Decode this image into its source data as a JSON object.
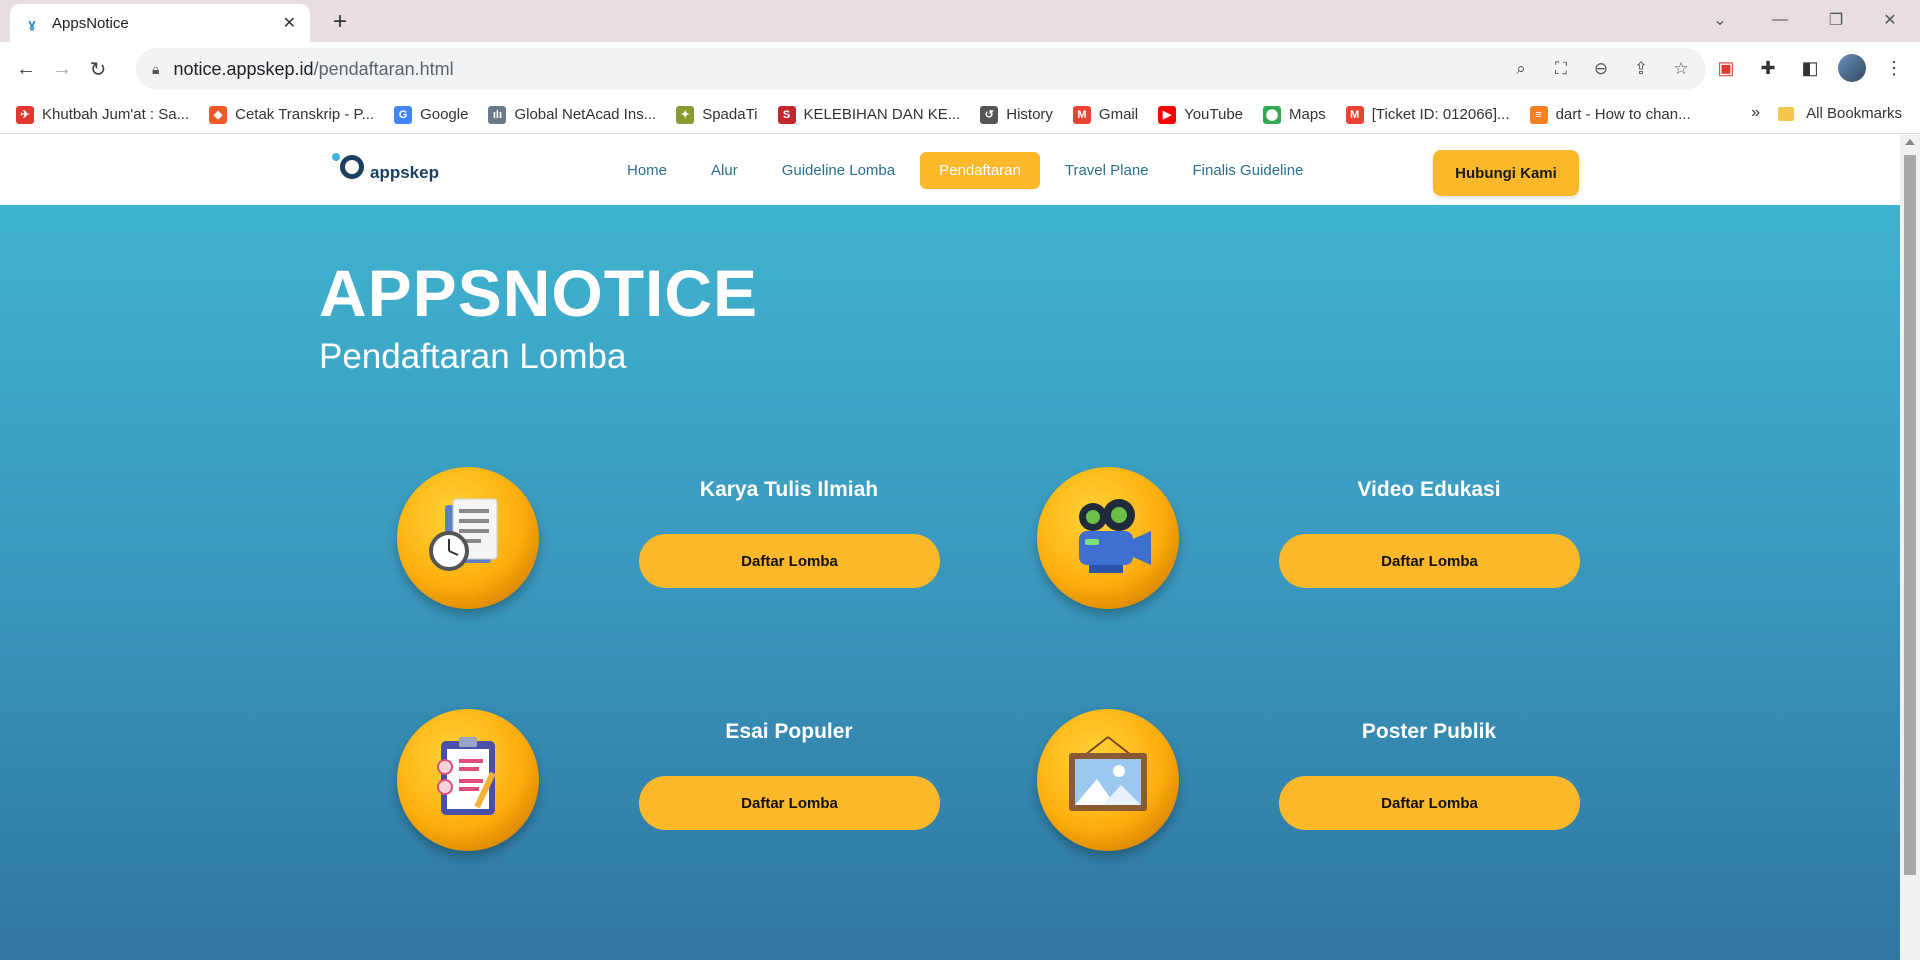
{
  "browser": {
    "tab_title": "AppsNotice",
    "url_domain": "notice.appskep.id",
    "url_path": "/pendaftaran.html",
    "bookmarks": [
      {
        "label": "Khutbah Jum'at : Sa...",
        "icon": "red-bird-icon",
        "color": "#e0382e"
      },
      {
        "label": "Cetak Transkrip - P...",
        "icon": "orange-hex-icon",
        "color": "#f05a28"
      },
      {
        "label": "Google",
        "icon": "google-icon",
        "color": "#4285f4"
      },
      {
        "label": "Global NetAcad Ins...",
        "icon": "cisco-icon",
        "color": "#6a7a8a"
      },
      {
        "label": "SpadaTi",
        "icon": "spadati-icon",
        "color": "#8a9a30"
      },
      {
        "label": "KELEBIHAN DAN KE...",
        "icon": "s-icon",
        "color": "#c0282e"
      },
      {
        "label": "History",
        "icon": "history-icon",
        "color": "#555555"
      },
      {
        "label": "Gmail",
        "icon": "gmail-icon",
        "color": "#ea4335"
      },
      {
        "label": "YouTube",
        "icon": "youtube-icon",
        "color": "#ff0000"
      },
      {
        "label": "Maps",
        "icon": "maps-icon",
        "color": "#34a853"
      },
      {
        "label": "[Ticket ID: 012066]...",
        "icon": "gmail-icon",
        "color": "#ea4335"
      },
      {
        "label": "dart - How to chan...",
        "icon": "stackoverflow-icon",
        "color": "#f48024"
      }
    ],
    "all_bookmarks": "All Bookmarks"
  },
  "site": {
    "logo_text": "appskep",
    "menu": [
      "Home",
      "Alur",
      "Guideline Lomba",
      "Pendaftaran",
      "Travel Plane",
      "Finalis Guideline"
    ],
    "active_menu": "Pendaftaran",
    "cta": "Hubungi Kami"
  },
  "hero": {
    "title": "APPSNOTICE",
    "subtitle": "Pendaftaran Lomba"
  },
  "competitions": [
    {
      "title": "Karya Tulis Ilmiah",
      "button": "Daftar Lomba",
      "icon": "document-clock-icon"
    },
    {
      "title": "Video Edukasi",
      "button": "Daftar Lomba",
      "icon": "video-camera-icon"
    },
    {
      "title": "Esai Populer",
      "button": "Daftar Lomba",
      "icon": "clipboard-checklist-icon"
    },
    {
      "title": "Poster Publik",
      "button": "Daftar Lomba",
      "icon": "picture-frame-icon"
    }
  ],
  "colors": {
    "accent": "#fbb82b",
    "hero_top": "#3fb3cf",
    "hero_bottom": "#2f76a0",
    "nav_text": "#2b6f8e"
  }
}
